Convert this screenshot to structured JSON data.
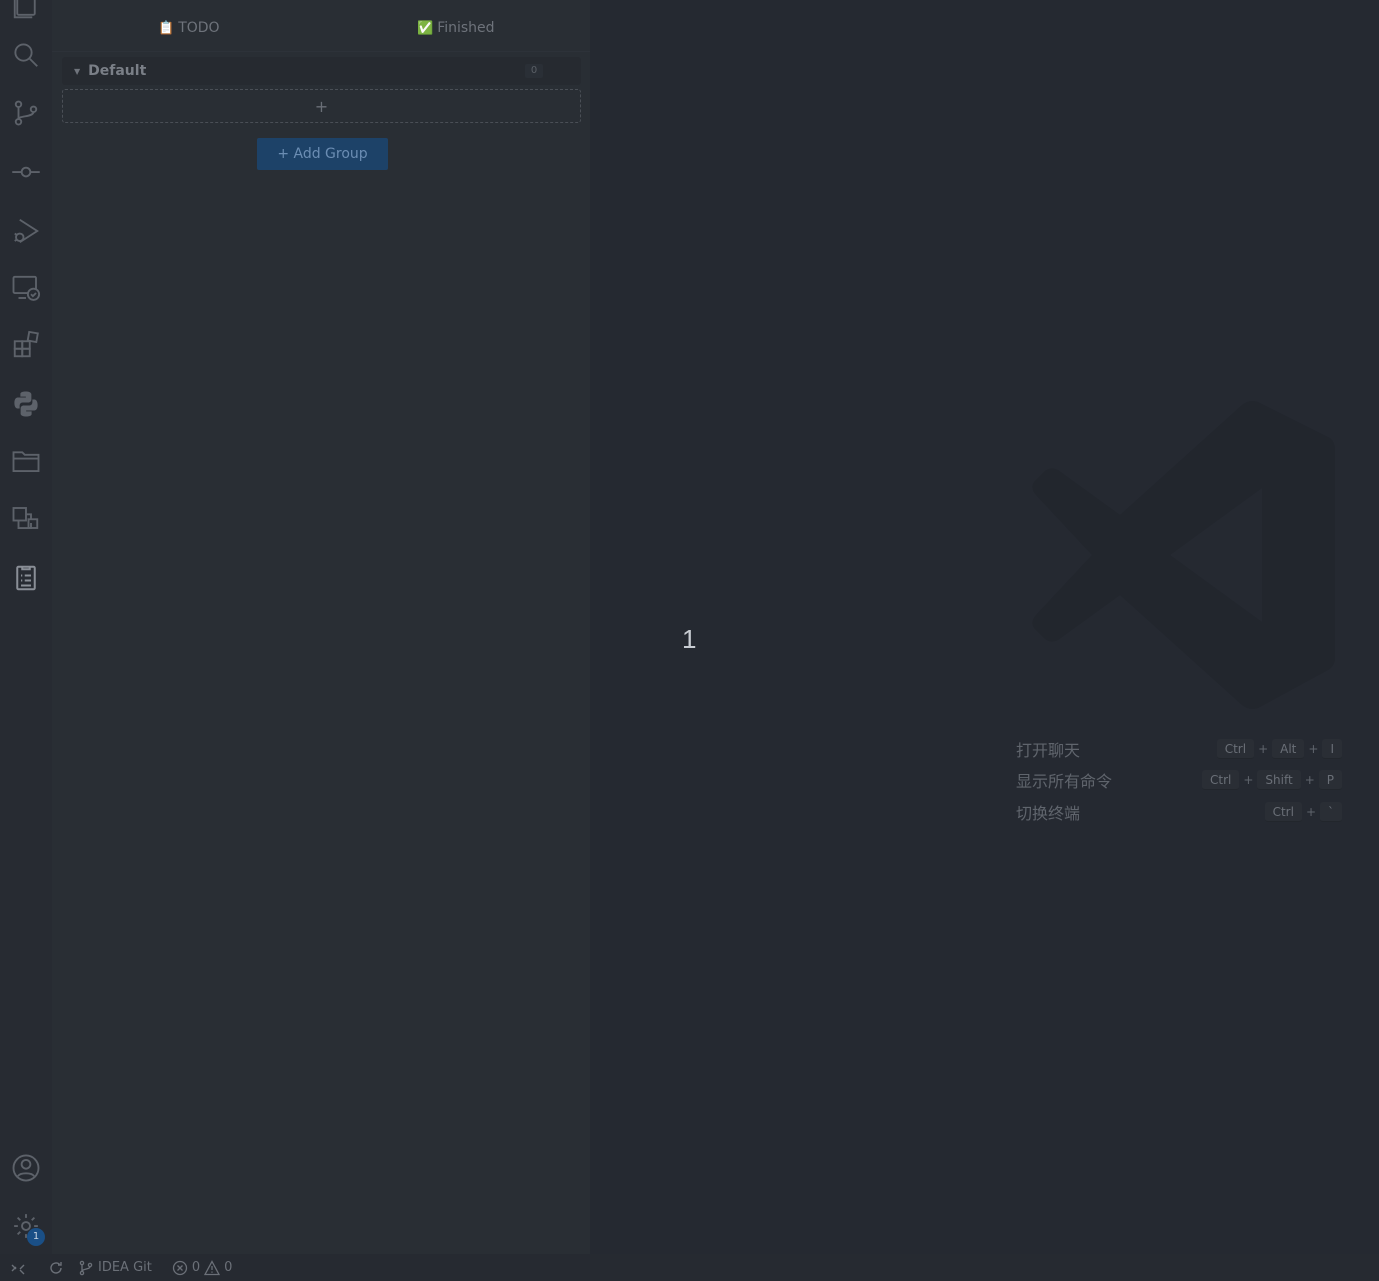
{
  "sidebar": {
    "tabs": [
      {
        "icon": "clipboard-icon",
        "glyph": "📋",
        "label": "TODO"
      },
      {
        "icon": "check-box-icon",
        "glyph": "✅",
        "label": "Finished"
      }
    ],
    "group": {
      "name": "Default",
      "count": "0"
    },
    "add_item_symbol": "+",
    "add_group_label": "+ Add Group"
  },
  "activity_bar": {
    "items": [
      "explorer-icon",
      "search-icon",
      "source-control-icon",
      "commit-icon",
      "run-debug-icon",
      "remote-explorer-icon",
      "extensions-icon",
      "python-icon",
      "folder-icon",
      "container-icon",
      "todo-list-icon"
    ],
    "bottom": [
      "accounts-icon",
      "settings-icon"
    ],
    "settings_badge": "1"
  },
  "editor": {
    "line_number": "1",
    "shortcuts": [
      {
        "label": "打开聊天",
        "keys": [
          "Ctrl",
          "Alt",
          "I"
        ]
      },
      {
        "label": "显示所有命令",
        "keys": [
          "Ctrl",
          "Shift",
          "P"
        ]
      },
      {
        "label": "切换终端",
        "keys": [
          "Ctrl",
          "`"
        ]
      }
    ]
  },
  "status_bar": {
    "branch": "IDEA Git",
    "errors": "0",
    "warnings": "0"
  }
}
